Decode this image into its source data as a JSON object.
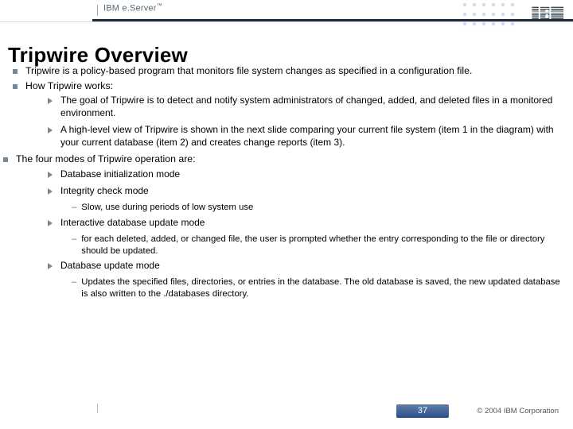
{
  "header": {
    "brand_prefix": "IBM e.Server",
    "brand_tm": "™"
  },
  "title": "Tripwire Overview",
  "points": {
    "p1": "Tripwire is a policy-based program that monitors file system changes as specified in a configuration file.",
    "p2": "How Tripwire works:",
    "p2a": "The goal of Tripwire is to detect and notify system administrators of changed, added, and deleted files in a monitored environment.",
    "p2b": "A high-level view of Tripwire is shown in the next slide comparing your current file system (item 1 in the diagram) with your current database (item 2) and creates change reports (item 3).",
    "p3": "The four modes of Tripwire operation are:",
    "p3a": "Database initialization mode",
    "p3b": "Integrity check mode",
    "p3b1": "Slow, use during periods of low system use",
    "p3c": "Interactive database update mode",
    "p3c1": "for each deleted, added, or changed file, the user is prompted whether the entry corresponding to the file or directory should be updated.",
    "p3d": "Database update mode",
    "p3d1": "Updates the specified files, directories, or entries in the database. The old database is saved, the new updated database is also written to the ./databases directory."
  },
  "footer": {
    "page": "37",
    "copyright": "© 2004 IBM Corporation"
  }
}
